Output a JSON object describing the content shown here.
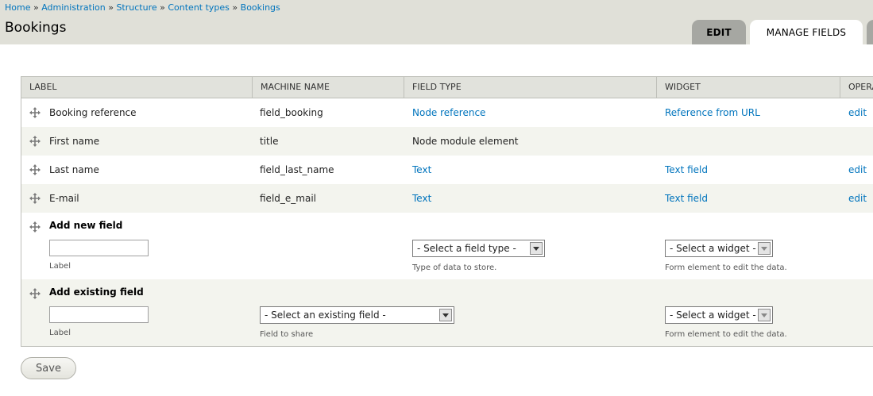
{
  "breadcrumb": [
    "Home",
    "Administration",
    "Structure",
    "Content types",
    "Bookings"
  ],
  "breadcrumb_separator": "»",
  "page_title": "Bookings",
  "tabs": {
    "edit": "EDIT",
    "manage_fields": "MANAGE FIELDS"
  },
  "table": {
    "headers": [
      "LABEL",
      "MACHINE NAME",
      "FIELD TYPE",
      "WIDGET",
      "OPERATIONS"
    ],
    "rows": [
      {
        "label": "Booking reference",
        "machine_name": "field_booking",
        "field_type": "Node reference",
        "widget": "Reference from URL",
        "op": "edit"
      },
      {
        "label": "First name",
        "machine_name": "title",
        "field_type": "Node module element",
        "widget": "",
        "op": ""
      },
      {
        "label": "Last name",
        "machine_name": "field_last_name",
        "field_type": "Text",
        "widget": "Text field",
        "op": "edit"
      },
      {
        "label": "E-mail",
        "machine_name": "field_e_mail",
        "field_type": "Text",
        "widget": "Text field",
        "op": "edit"
      }
    ]
  },
  "add_new": {
    "title": "Add new field",
    "label_value": "",
    "label_desc": "Label",
    "field_type_select": "- Select a field type -",
    "field_type_desc": "Type of data to store.",
    "widget_select": "- Select a widget -",
    "widget_desc": "Form element to edit the data."
  },
  "add_existing": {
    "title": "Add existing field",
    "label_value": "",
    "label_desc": "Label",
    "field_select": "- Select an existing field -",
    "field_desc": "Field to share",
    "widget_select": "- Select a widget -",
    "widget_desc": "Form element to edit the data."
  },
  "save_label": "Save",
  "colors": {
    "link": "#0074bd",
    "header_bg": "#e0e0d8",
    "row_alt": "#f3f4ee"
  }
}
